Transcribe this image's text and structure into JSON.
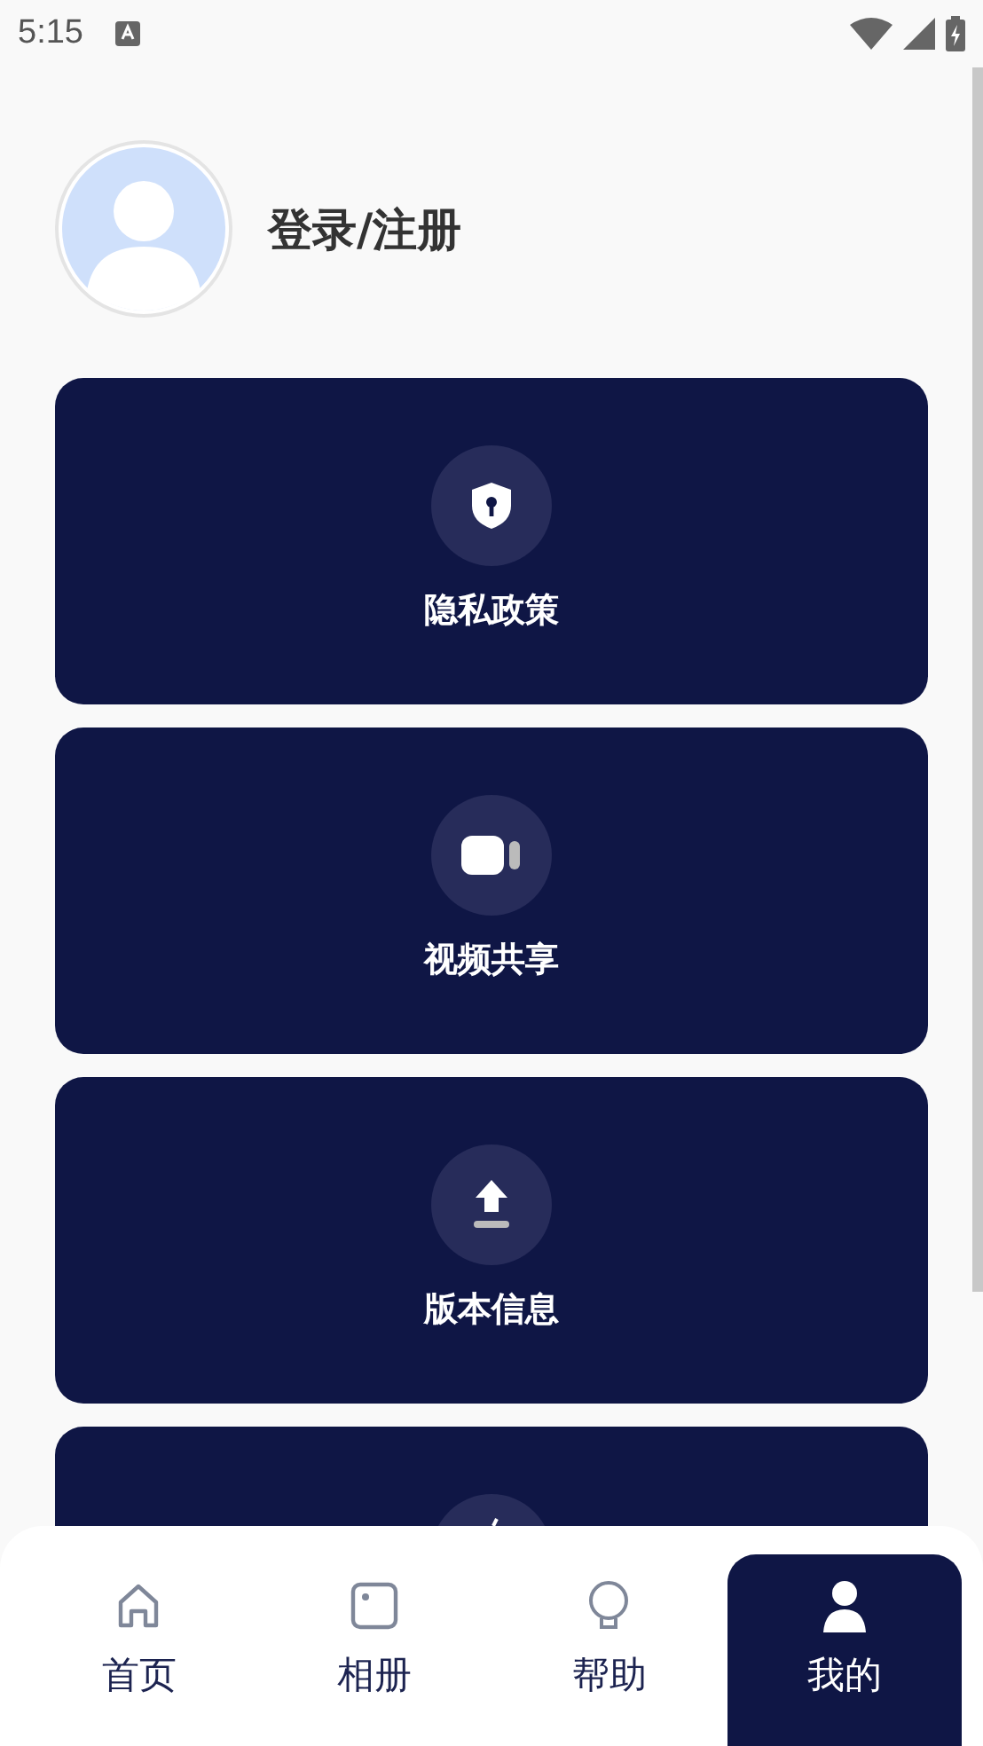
{
  "status_bar": {
    "time": "5:15"
  },
  "profile": {
    "title": "登录/注册"
  },
  "cards": [
    {
      "kind": "shield",
      "label": "隐私政策"
    },
    {
      "kind": "video",
      "label": "视频共享"
    },
    {
      "kind": "upload",
      "label": "版本信息"
    },
    {
      "kind": "pencil"
    }
  ],
  "tabs": [
    {
      "kind": "home",
      "label": "首页",
      "selected": false
    },
    {
      "kind": "album",
      "label": "相册",
      "selected": false
    },
    {
      "kind": "bulb",
      "label": "帮助",
      "selected": false
    },
    {
      "kind": "person",
      "label": "我的",
      "selected": true
    }
  ]
}
